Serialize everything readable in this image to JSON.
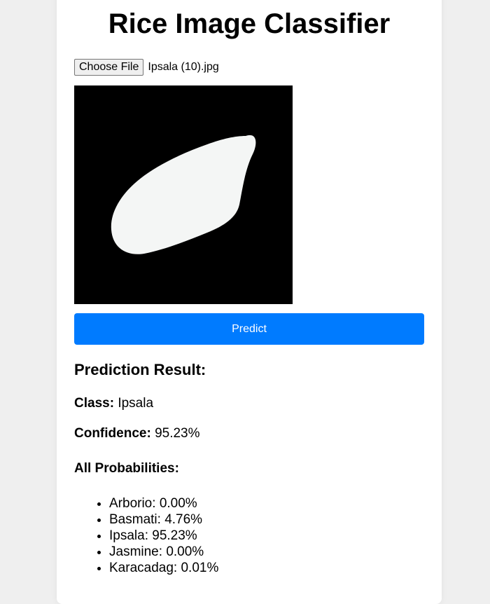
{
  "app": {
    "title": "Rice Image Classifier"
  },
  "upload": {
    "button_label": "Choose File",
    "file_name": "Ipsala (10).jpg"
  },
  "actions": {
    "predict_label": "Predict"
  },
  "result": {
    "heading": "Prediction Result:",
    "class_label": "Class:",
    "class_value": "Ipsala",
    "confidence_label": "Confidence:",
    "confidence_value": "95.23%",
    "probabilities_heading": "All Probabilities:",
    "probabilities": [
      {
        "name": "Arborio",
        "value": "0.00%"
      },
      {
        "name": "Basmati",
        "value": "4.76%"
      },
      {
        "name": "Ipsala",
        "value": "95.23%"
      },
      {
        "name": "Jasmine",
        "value": "0.00%"
      },
      {
        "name": "Karacadag",
        "value": "0.01%"
      }
    ]
  },
  "colors": {
    "accent": "#007bff",
    "page_background": "#efefef",
    "card_background": "#ffffff"
  }
}
